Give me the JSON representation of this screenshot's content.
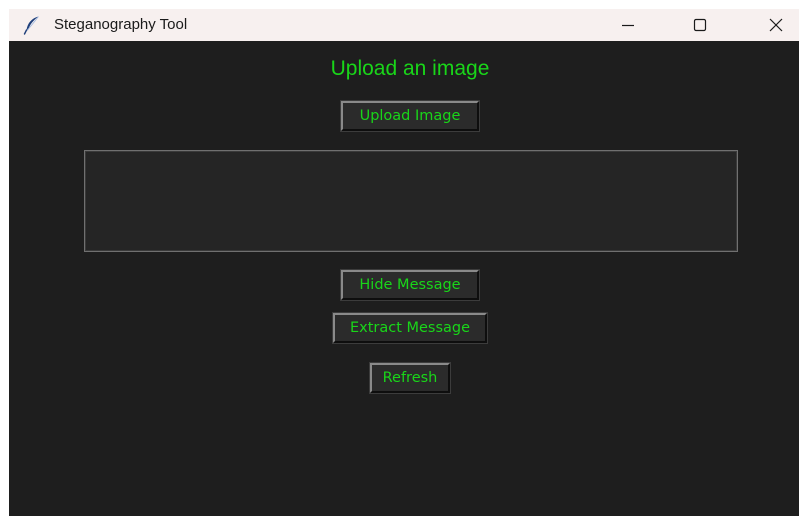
{
  "window": {
    "title": "Steganography Tool",
    "icon": "feather-icon",
    "controls": [
      "minimize-icon",
      "maximize-icon",
      "close-icon"
    ]
  },
  "main": {
    "heading": "Upload an image",
    "upload_button": "Upload Image",
    "message_box": {
      "value": ""
    },
    "hide_button": "Hide Message",
    "extract_button": "Extract Message",
    "refresh_button": "Refresh"
  },
  "colors": {
    "background": "#1e1e1e",
    "accent_text": "#19d619",
    "button_bg": "#2b2b2b",
    "titlebar_bg": "#f7f0ef"
  }
}
